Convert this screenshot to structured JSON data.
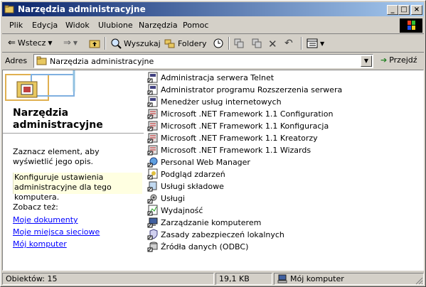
{
  "window": {
    "title": "Narzędzia administracyjne"
  },
  "menu": [
    "Plik",
    "Edycja",
    "Widok",
    "Ulubione",
    "Narzędzia",
    "Pomoc"
  ],
  "toolbar": {
    "back": "Wstecz",
    "search": "Wyszukaj",
    "folders": "Foldery"
  },
  "address": {
    "label": "Adres",
    "value": "Narzędzia administracyjne",
    "go": "Przejdź"
  },
  "left": {
    "title": "Narzędzia administracyjne",
    "hint": "Zaznacz element, aby wyświetlić jego opis.",
    "info": "Konfiguruje ustawienia administracyjne dla tego komputera.",
    "see_also": "Zobacz też:",
    "links": [
      "Moje dokumenty",
      "Moje miejsca sieciowe",
      "Mój komputer"
    ]
  },
  "items": [
    "Administracja serwera Telnet",
    "Administrator programu Rozszerzenia serwera",
    "Menedżer usług internetowych",
    "Microsoft .NET Framework 1.1 Configuration",
    "Microsoft .NET Framework 1.1 Konfiguracja",
    "Microsoft .NET Framework 1.1 Kreatorzy",
    "Microsoft .NET Framework 1.1 Wizards",
    "Personal Web Manager",
    "Podgląd zdarzeń",
    "Usługi składowe",
    "Usługi",
    "Wydajność",
    "Zarządzanie komputerem",
    "Zasady zabezpieczeń lokalnych",
    "Źródła danych (ODBC)"
  ],
  "status": {
    "count": "Obiektów: 15",
    "size": "19,1 KB",
    "location": "Mój komputer"
  },
  "colors": {
    "title_start": "#0a246a",
    "title_end": "#a6caf0",
    "link": "#0000ff",
    "info_bg": "#ffffe1"
  }
}
